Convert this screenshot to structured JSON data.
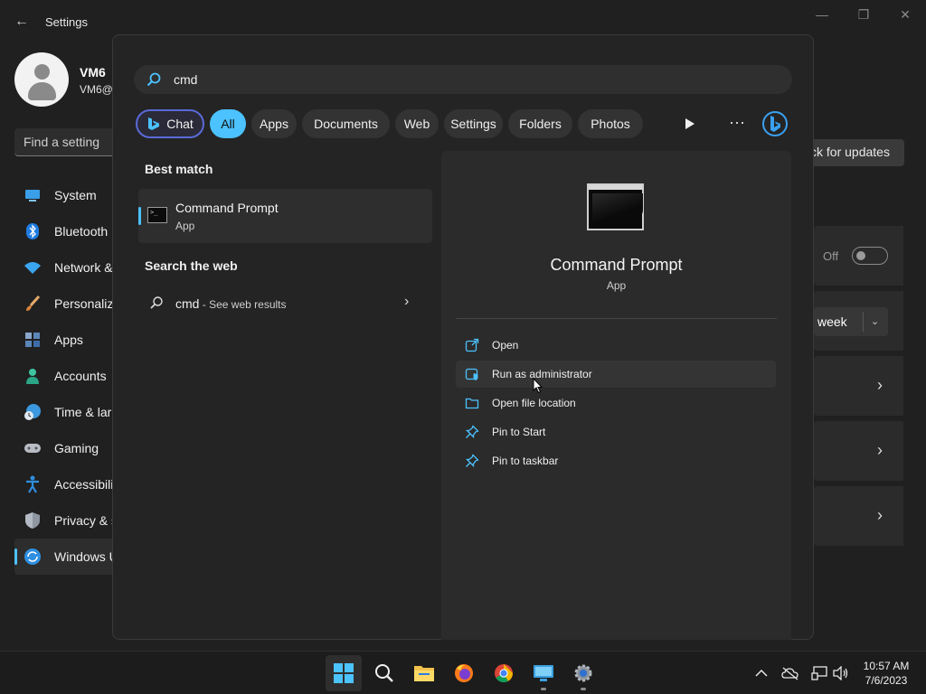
{
  "settings_window": {
    "title": "Settings",
    "back_glyph": "←",
    "controls": {
      "minimize": "—",
      "maximize": "❐",
      "close": "✕"
    },
    "profile": {
      "name": "VM6",
      "email": "VM6@"
    },
    "find_setting_placeholder": "Find a setting",
    "nav": [
      {
        "label": "System",
        "icon": "system-icon"
      },
      {
        "label": "Bluetooth",
        "icon": "bluetooth-icon"
      },
      {
        "label": "Network &",
        "icon": "wifi-icon"
      },
      {
        "label": "Personaliz",
        "icon": "brush-icon"
      },
      {
        "label": "Apps",
        "icon": "apps-icon"
      },
      {
        "label": "Accounts",
        "icon": "person-icon"
      },
      {
        "label": "Time & lar",
        "icon": "clock-globe-icon"
      },
      {
        "label": "Gaming",
        "icon": "gamepad-icon"
      },
      {
        "label": "Accessibilit",
        "icon": "accessibility-icon"
      },
      {
        "label": "Privacy & s",
        "icon": "shield-icon"
      },
      {
        "label": "Windows U",
        "icon": "windows-update-icon",
        "active": true
      }
    ],
    "check_updates_label": "ck for updates",
    "off_label": "Off",
    "week_value": "week"
  },
  "search_flyout": {
    "query": "cmd",
    "filters": {
      "chat": "Chat",
      "all": "All",
      "apps": "Apps",
      "documents": "Documents",
      "web": "Web",
      "settings": "Settings",
      "folders": "Folders",
      "photos": "Photos"
    },
    "more_glyph": "···",
    "best_match_heading": "Best match",
    "best_match": {
      "title": "Command Prompt",
      "subtitle": "App"
    },
    "search_web_heading": "Search the web",
    "web_result": {
      "query": "cmd",
      "suffix": " - See web results"
    },
    "preview": {
      "title": "Command Prompt",
      "subtitle": "App",
      "actions": [
        {
          "label": "Open",
          "icon": "open-external-icon"
        },
        {
          "label": "Run as administrator",
          "icon": "admin-shield-icon"
        },
        {
          "label": "Open file location",
          "icon": "folder-icon"
        },
        {
          "label": "Pin to Start",
          "icon": "pin-icon"
        },
        {
          "label": "Pin to taskbar",
          "icon": "pin-icon"
        }
      ]
    }
  },
  "taskbar": {
    "apps": [
      "Start",
      "Search",
      "File Explorer",
      "Firefox",
      "Chrome",
      "Remote Desktop",
      "Settings"
    ],
    "clock": {
      "time": "10:57 AM",
      "date": "7/6/2023"
    }
  },
  "colors": {
    "accent": "#4cc2ff",
    "background": "#202020",
    "flyout": "#242424",
    "chat_border": "#5a6ad8"
  }
}
